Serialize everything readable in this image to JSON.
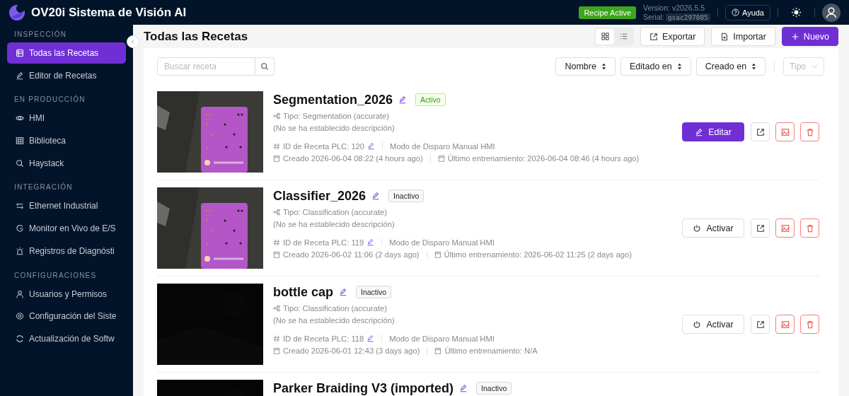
{
  "header": {
    "title": "OV20i Sistema de Visión AI",
    "status_badge": "Recipe Active",
    "version": "Version: v2026.5.5",
    "serial_label": "Serial:",
    "serial": "gsac297085",
    "help_button": "Ayuda"
  },
  "sidebar": {
    "sections": [
      {
        "title": "INSPECCIÓN",
        "items": [
          {
            "label": "Todas las Recetas",
            "selected": true
          },
          {
            "label": "Editor de Recetas",
            "selected": false
          }
        ]
      },
      {
        "title": "EN PRODUCCIÓN",
        "items": [
          {
            "label": "HMI",
            "selected": false
          },
          {
            "label": "Biblioteca",
            "selected": false
          },
          {
            "label": "Haystack",
            "selected": false
          }
        ]
      },
      {
        "title": "INTEGRACIÓN",
        "items": [
          {
            "label": "Ethernet Industrial",
            "selected": false
          },
          {
            "label": "Monitor en Vivo de E/S",
            "selected": false
          },
          {
            "label": "Registros de Diagnósti",
            "selected": false
          }
        ]
      },
      {
        "title": "CONFIGURACIONES",
        "items": [
          {
            "label": "Usuarios y Permisos",
            "selected": false
          },
          {
            "label": "Configuración del Siste",
            "selected": false
          },
          {
            "label": "Actualización de Softw",
            "selected": false
          }
        ]
      }
    ]
  },
  "page": {
    "title": "Todas las Recetas",
    "views": [
      {
        "kind": "grid",
        "selected": true
      },
      {
        "kind": "list",
        "selected": false
      }
    ],
    "export_button": "Exportar",
    "import_button": "Importar",
    "new_button": "Nuevo"
  },
  "filters": {
    "search": {
      "placeholder": "Buscar receta"
    },
    "sorts": [
      "Nombre",
      "Editado en",
      "Creado en"
    ],
    "type_filter": {
      "placeholder": "Tipo"
    }
  },
  "recipes": [
    {
      "name": "Segmentation_2026",
      "active": true,
      "status": "Activo",
      "type": "Tipo: Segmentation (accurate)",
      "description": "(No se ha establecido descripción)",
      "plc_id": "ID de Receta PLC: 120",
      "trigger": "Modo de Disparo Manual HMI",
      "created": "Creado 2026-06-04 08:22 (4 hours ago)",
      "trained": "Último entrenamiento: 2026-06-04 08:46 (4 hours ago)",
      "action": "Editar"
    },
    {
      "name": "Classifier_2026",
      "active": false,
      "status": "Inactivo",
      "type": "Tipo: Classification (accurate)",
      "description": "(No se ha establecido descripción)",
      "plc_id": "ID de Receta PLC: 119",
      "trigger": "Modo de Disparo Manual HMI",
      "created": "Creado 2026-06-02 11:06 (2 days ago)",
      "trained": "Último entrenamiento: 2026-06-02 11:25 (2 days ago)",
      "action": "Activar"
    },
    {
      "name": "bottle cap",
      "active": false,
      "status": "Inactivo",
      "type": "Tipo: Classification (accurate)",
      "description": "(No se ha establecido descripción)",
      "plc_id": "ID de Receta PLC: 118",
      "trigger": "Modo de Disparo Manual HMI",
      "created": "Creado 2026-06-01 12:43 (3 days ago)",
      "trained": "Último entrenamiento: N/A",
      "action": "Activar"
    },
    {
      "name": "Parker Braiding V3 (imported)",
      "active": false,
      "status": "Inactivo"
    }
  ]
}
